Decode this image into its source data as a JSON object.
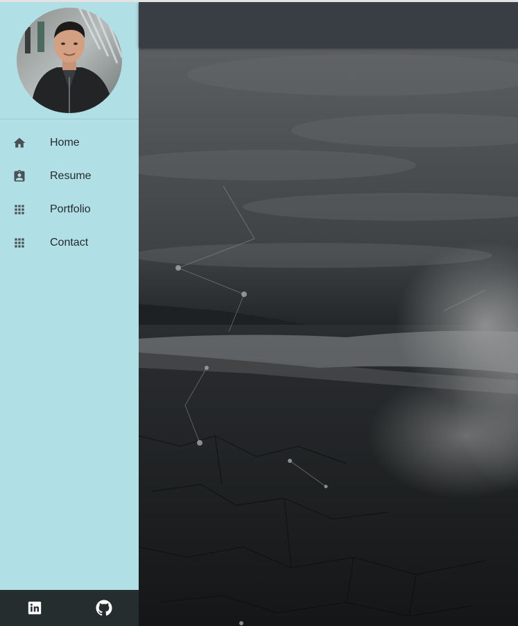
{
  "sidebar": {
    "items": [
      {
        "label": "Home",
        "icon": "home-icon"
      },
      {
        "label": "Resume",
        "icon": "badge-icon"
      },
      {
        "label": "Portfolio",
        "icon": "grid-icon"
      },
      {
        "label": "Contact",
        "icon": "grid-icon"
      }
    ],
    "social": [
      {
        "icon": "linkedin-icon"
      },
      {
        "icon": "github-icon"
      }
    ]
  },
  "colors": {
    "sidebar_bg": "#b0dfe5",
    "topbar_bg": "#393e44",
    "social_bg": "#252d2f",
    "icon_color": "#4a5054"
  }
}
